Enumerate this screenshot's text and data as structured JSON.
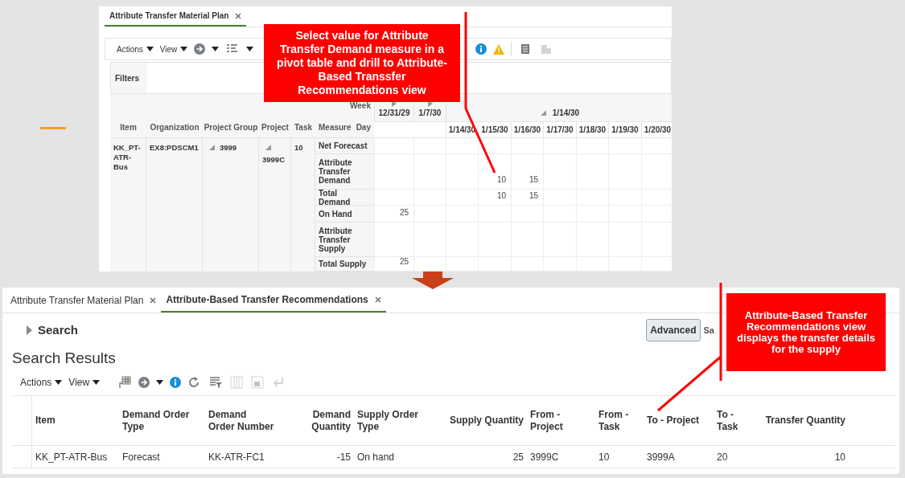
{
  "top_screen": {
    "tabs": [
      {
        "label": "Attribute Transfer Material Plan",
        "selected": true
      }
    ],
    "toolbar": {
      "actions": "Actions",
      "view": "View"
    },
    "filters_label": "Filters",
    "pivot": {
      "row_headers": [
        "Item",
        "Organization",
        "Project Group",
        "Project",
        "Task",
        "Measure"
      ],
      "week_label": "Week",
      "day_label": "Day",
      "weeks": [
        {
          "label": "12/31/29",
          "expanded": false
        },
        {
          "label": "1/7/30",
          "expanded": false
        },
        {
          "label": "1/14/30",
          "expanded": true
        }
      ],
      "days": [
        "1/14/30",
        "1/15/30",
        "1/16/30",
        "1/17/30",
        "1/18/30",
        "1/19/30",
        "1/20/30"
      ],
      "item": "KK_PT-ATR-Bus",
      "organization": "EX8:PDSCM1",
      "project_group": "3999",
      "project": "3999C",
      "task": "10",
      "measures": [
        {
          "name": "Net Forecast",
          "cells": [
            {
              "kind": "empty"
            },
            {
              "kind": "empty"
            },
            {
              "kind": "empty"
            },
            {
              "kind": "empty"
            },
            {
              "kind": "empty"
            },
            {
              "kind": "empty"
            },
            {
              "kind": "empty"
            },
            {
              "kind": "empty"
            },
            {
              "kind": "empty"
            }
          ]
        },
        {
          "name": "Attribute Transfer Demand",
          "cells": [
            {
              "kind": "empty"
            },
            {
              "kind": "empty"
            },
            {
              "kind": "empty"
            },
            {
              "kind": "value",
              "text": "10"
            },
            {
              "kind": "value",
              "text": "15"
            },
            {
              "kind": "empty"
            },
            {
              "kind": "empty"
            },
            {
              "kind": "empty"
            },
            {
              "kind": "empty"
            }
          ]
        },
        {
          "name": "Total Demand",
          "cells": [
            {
              "kind": "empty"
            },
            {
              "kind": "empty"
            },
            {
              "kind": "empty"
            },
            {
              "kind": "value",
              "text": "10"
            },
            {
              "kind": "value",
              "text": "15"
            },
            {
              "kind": "empty"
            },
            {
              "kind": "empty"
            },
            {
              "kind": "empty"
            },
            {
              "kind": "empty"
            }
          ]
        },
        {
          "name": "On Hand",
          "cells": [
            {
              "kind": "value",
              "text": "25"
            },
            {
              "kind": "empty"
            },
            {
              "kind": "empty"
            },
            {
              "kind": "empty"
            },
            {
              "kind": "empty"
            },
            {
              "kind": "empty"
            },
            {
              "kind": "empty"
            },
            {
              "kind": "empty"
            },
            {
              "kind": "empty"
            }
          ]
        },
        {
          "name": "Attribute Transfer Supply",
          "cells": [
            {
              "kind": "empty"
            },
            {
              "kind": "empty"
            },
            {
              "kind": "empty"
            },
            {
              "kind": "empty"
            },
            {
              "kind": "empty"
            },
            {
              "kind": "empty"
            },
            {
              "kind": "empty"
            },
            {
              "kind": "empty"
            },
            {
              "kind": "empty"
            }
          ]
        },
        {
          "name": "Total Supply",
          "cells": [
            {
              "kind": "value",
              "text": "25"
            },
            {
              "kind": "empty"
            },
            {
              "kind": "empty"
            },
            {
              "kind": "empty"
            },
            {
              "kind": "empty"
            },
            {
              "kind": "empty"
            },
            {
              "kind": "empty"
            },
            {
              "kind": "empty"
            },
            {
              "kind": "empty"
            }
          ]
        }
      ]
    }
  },
  "bottom_screen": {
    "tabs": [
      {
        "label": "Attribute Transfer Material Plan",
        "selected": false
      },
      {
        "label": "Attribute-Based Transfer Recommendations",
        "selected": true
      }
    ],
    "search_label": "Search",
    "advanced_button": "Advanced",
    "save_button": "Sa",
    "results_title": "Search Results",
    "toolbar": {
      "actions": "Actions",
      "view": "View"
    },
    "table": {
      "columns": [
        {
          "label": "Item",
          "kind": "text"
        },
        {
          "label": "Demand Order Type",
          "kind": "text"
        },
        {
          "label": "Demand Order Number",
          "kind": "text"
        },
        {
          "label": "Demand Quantity",
          "kind": "number"
        },
        {
          "label": "Supply Order Type",
          "kind": "text"
        },
        {
          "label": "Supply Quantity",
          "kind": "number"
        },
        {
          "label": "From - Project",
          "kind": "text"
        },
        {
          "label": "From - Task",
          "kind": "text"
        },
        {
          "label": "To - Project",
          "kind": "text"
        },
        {
          "label": "To - Task",
          "kind": "text"
        },
        {
          "label": "Transfer Quantity",
          "kind": "number"
        }
      ],
      "rows": [
        [
          "KK_PT-ATR-Bus",
          "Forecast",
          "KK-ATR-FC1",
          "-15",
          "On hand",
          "25",
          "3999C",
          "10",
          "3999A",
          "20",
          "10"
        ]
      ]
    }
  },
  "callouts": [
    "Select value for Attribute Transfer Demand measure in a pivot table and drill to Attribute-Based Transsfer Recommendations view",
    "Attribute-Based Transfer Recommendations view displays the transfer details for the supply"
  ]
}
